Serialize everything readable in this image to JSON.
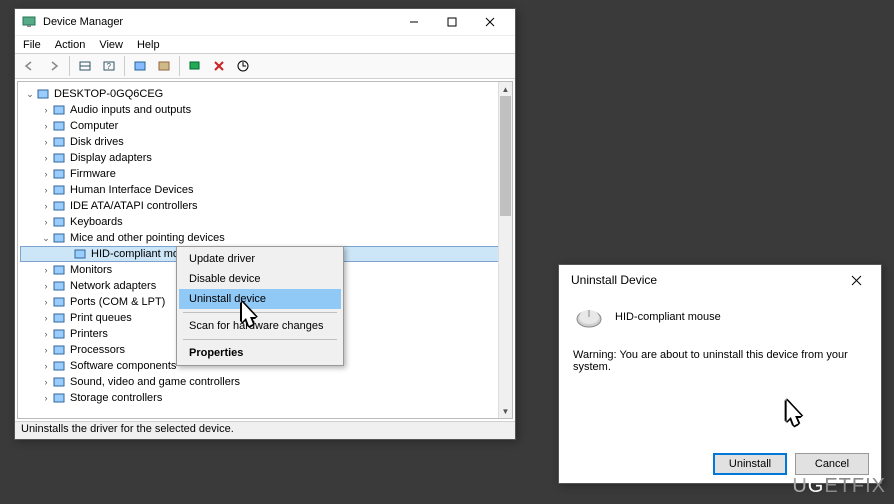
{
  "dm": {
    "title": "Device Manager",
    "menu": [
      "File",
      "Action",
      "View",
      "Help"
    ],
    "root": "DESKTOP-0GQ6CEG",
    "nodes": [
      {
        "label": "Audio inputs and outputs",
        "icon": "audio"
      },
      {
        "label": "Computer",
        "icon": "computer"
      },
      {
        "label": "Disk drives",
        "icon": "disk"
      },
      {
        "label": "Display adapters",
        "icon": "display"
      },
      {
        "label": "Firmware",
        "icon": "chip"
      },
      {
        "label": "Human Interface Devices",
        "icon": "hid"
      },
      {
        "label": "IDE ATA/ATAPI controllers",
        "icon": "ide"
      },
      {
        "label": "Keyboards",
        "icon": "keyboard"
      },
      {
        "label": "Mice and other pointing devices",
        "icon": "mouse",
        "expanded": true,
        "children": [
          {
            "label": "HID-compliant mouse",
            "icon": "mouse",
            "selected": true
          }
        ]
      },
      {
        "label": "Monitors",
        "icon": "monitor"
      },
      {
        "label": "Network adapters",
        "icon": "network"
      },
      {
        "label": "Ports (COM & LPT)",
        "icon": "port"
      },
      {
        "label": "Print queues",
        "icon": "printer"
      },
      {
        "label": "Printers",
        "icon": "printer"
      },
      {
        "label": "Processors",
        "icon": "cpu"
      },
      {
        "label": "Software components",
        "icon": "soft"
      },
      {
        "label": "Sound, video and game controllers",
        "icon": "sound"
      },
      {
        "label": "Storage controllers",
        "icon": "storage"
      }
    ],
    "status": "Uninstalls the driver for the selected device."
  },
  "ctx": {
    "items": [
      {
        "label": "Update driver"
      },
      {
        "label": "Disable device"
      },
      {
        "label": "Uninstall device",
        "highlight": true
      },
      {
        "sep": true
      },
      {
        "label": "Scan for hardware changes"
      },
      {
        "sep": true
      },
      {
        "label": "Properties",
        "bold": true
      }
    ]
  },
  "dlg": {
    "title": "Uninstall Device",
    "device": "HID-compliant mouse",
    "warning": "Warning: You are about to uninstall this device from your system.",
    "buttons": {
      "uninstall": "Uninstall",
      "cancel": "Cancel"
    }
  },
  "watermark": "UGETFIX"
}
